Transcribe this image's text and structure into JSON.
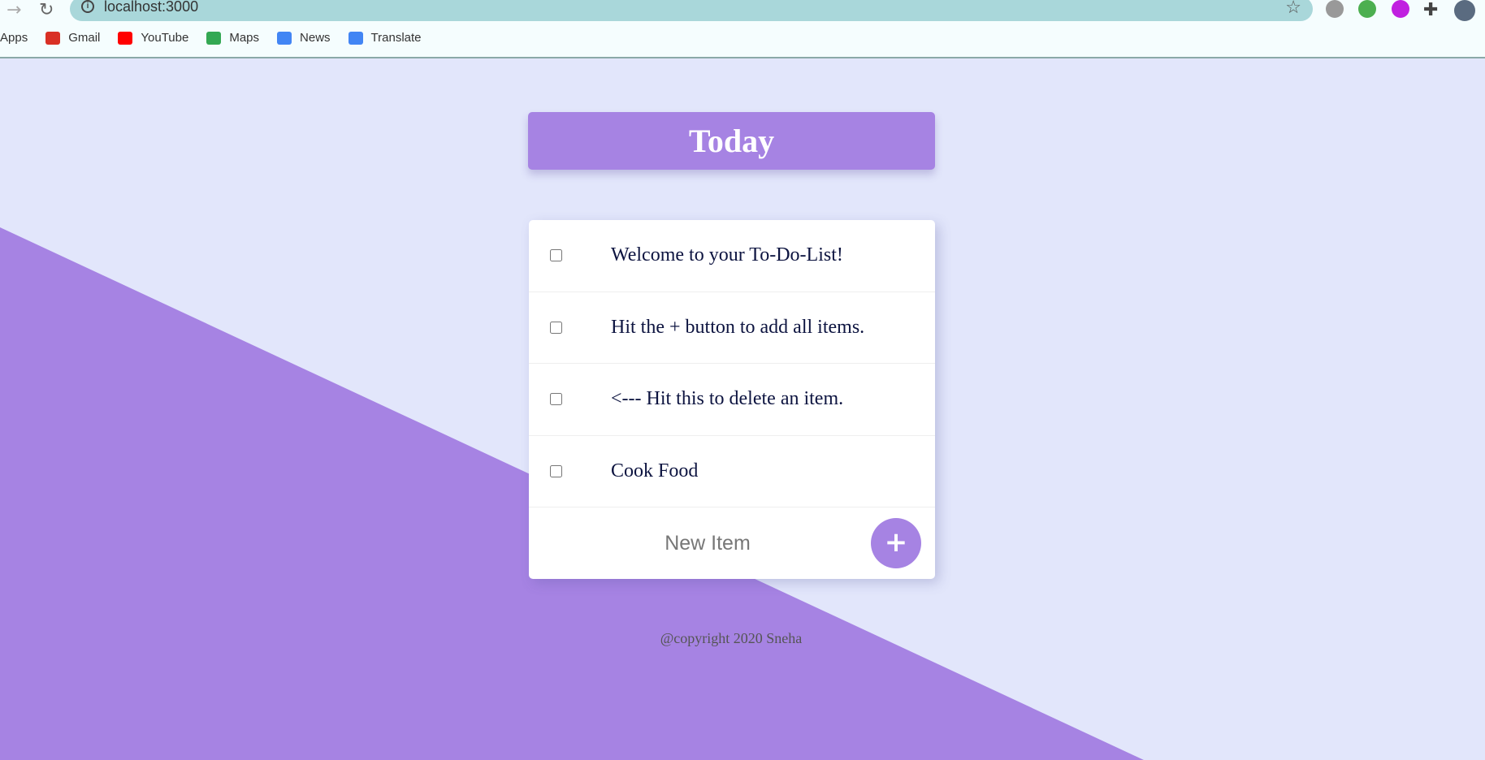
{
  "browser": {
    "url": "localhost:3000",
    "bookmarks": [
      {
        "label": "Apps",
        "icon": "apps-icon"
      },
      {
        "label": "Gmail",
        "icon": "gmail-icon",
        "color": "#d93025"
      },
      {
        "label": "YouTube",
        "icon": "youtube-icon",
        "color": "#ff0000"
      },
      {
        "label": "Maps",
        "icon": "maps-icon",
        "color": "#34a853"
      },
      {
        "label": "News",
        "icon": "news-icon",
        "color": "#4285f4"
      },
      {
        "label": "Translate",
        "icon": "translate-icon",
        "color": "#4285f4"
      }
    ]
  },
  "colors": {
    "accent": "#a683e3",
    "background": "#e2e6fb"
  },
  "list": {
    "title": "Today",
    "items": [
      "Welcome to your To-Do-List!",
      "Hit the + button to add all items.",
      "<--- Hit this to delete an item.",
      "Cook Food"
    ],
    "new_item_placeholder": "New Item",
    "add_label": "+"
  },
  "footer": "@copyright 2020 Sneha"
}
